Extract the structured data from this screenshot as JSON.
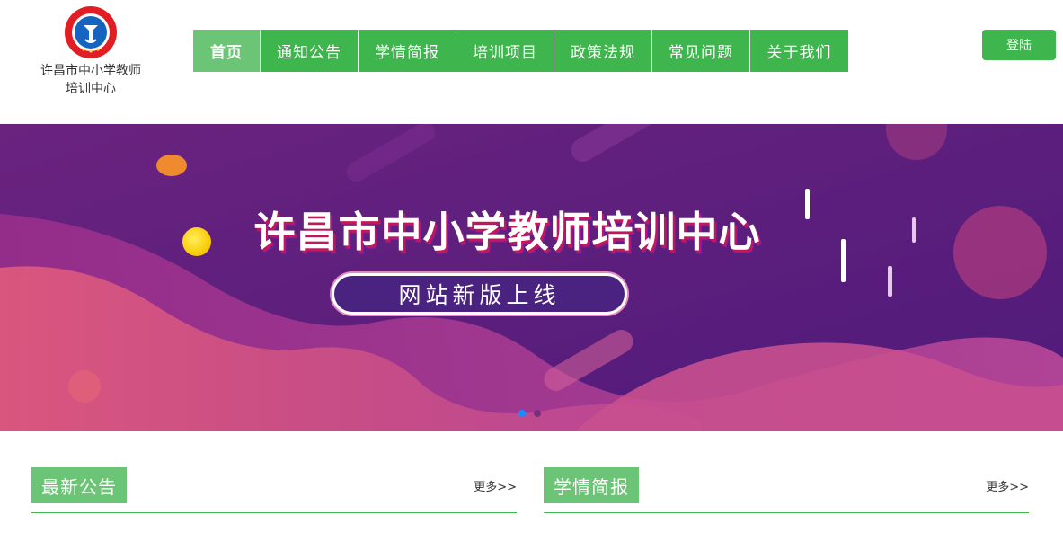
{
  "site": {
    "logo_text_line1": "许昌市中小学教师",
    "logo_text_line2": "培训中心"
  },
  "nav": {
    "items": [
      {
        "label": "首页"
      },
      {
        "label": "通知公告"
      },
      {
        "label": "学情简报"
      },
      {
        "label": "培训项目"
      },
      {
        "label": "政策法规"
      },
      {
        "label": "常见问题"
      },
      {
        "label": "关于我们"
      }
    ],
    "active_index": 0
  },
  "login": {
    "label": "登陆"
  },
  "banner": {
    "title": "许昌市中小学教师培训中心",
    "subtitle": "网站新版上线",
    "slide_count": 2,
    "active_slide": 0
  },
  "sections": {
    "notices": {
      "title": "最新公告",
      "more": "更多>>"
    },
    "reports": {
      "title": "学情简报",
      "more": "更多>>"
    }
  },
  "colors": {
    "brand_green": "#3fb54d",
    "active_green": "#6cc576",
    "banner_purple": "#5b1f7f"
  },
  "icons": {
    "logo": "school-emblem-icon"
  }
}
